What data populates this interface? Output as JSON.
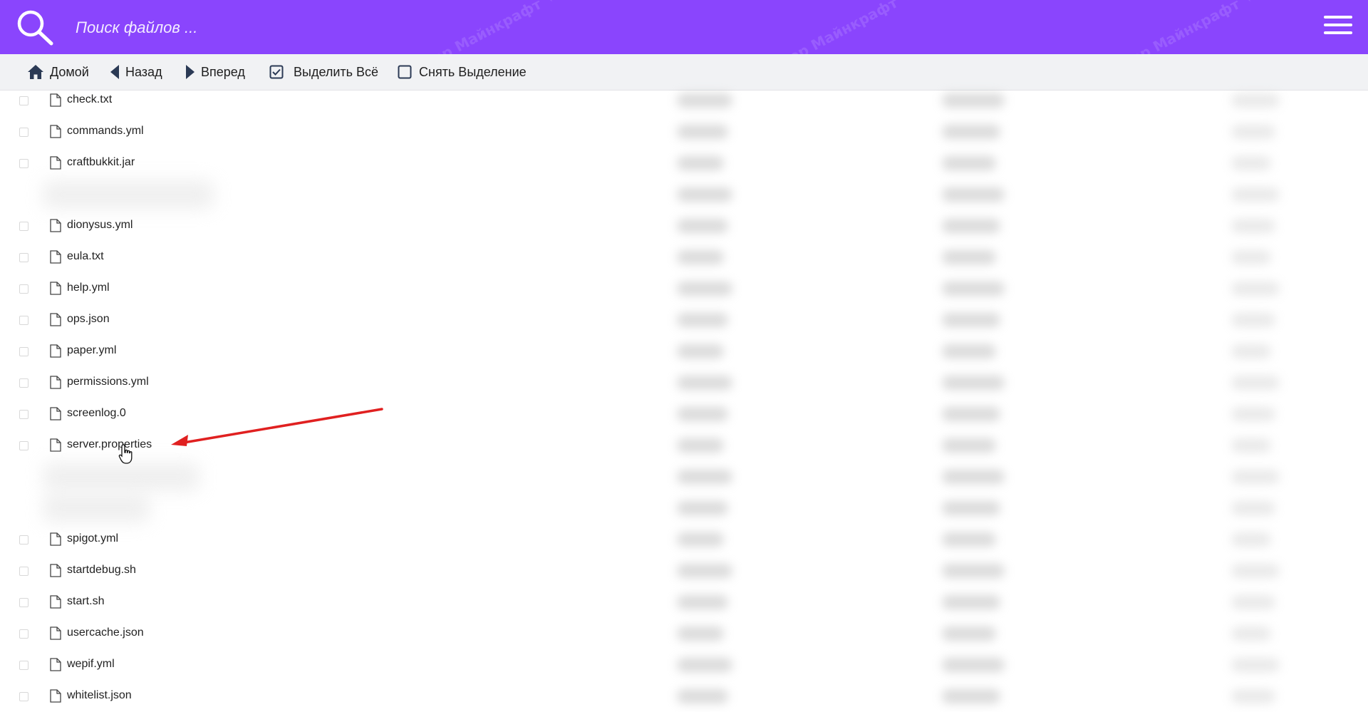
{
  "header": {
    "search_placeholder": "Поиск файлов ...",
    "watermark": "Твой Сервер Майнкрафт ✦ Mugee.Host",
    "accent": "#8a45fd"
  },
  "toolbar": {
    "home_label": "Домой",
    "back_label": "Назад",
    "forward_label": "Вперед",
    "select_all_label": "Выделить Всё",
    "deselect_label": "Снять Выделение"
  },
  "files": [
    "check.txt",
    "commands.yml",
    "craftbukkit.jar",
    "",
    "dionysus.yml",
    "eula.txt",
    "help.yml",
    "ops.json",
    "paper.yml",
    "permissions.yml",
    "screenlog.0",
    "server.properties",
    "",
    "",
    "spigot.yml",
    "startdebug.sh",
    "start.sh",
    "usercache.json",
    "wepif.yml",
    "whitelist.json"
  ],
  "annotation": {
    "arrow_color": "#e02020"
  }
}
